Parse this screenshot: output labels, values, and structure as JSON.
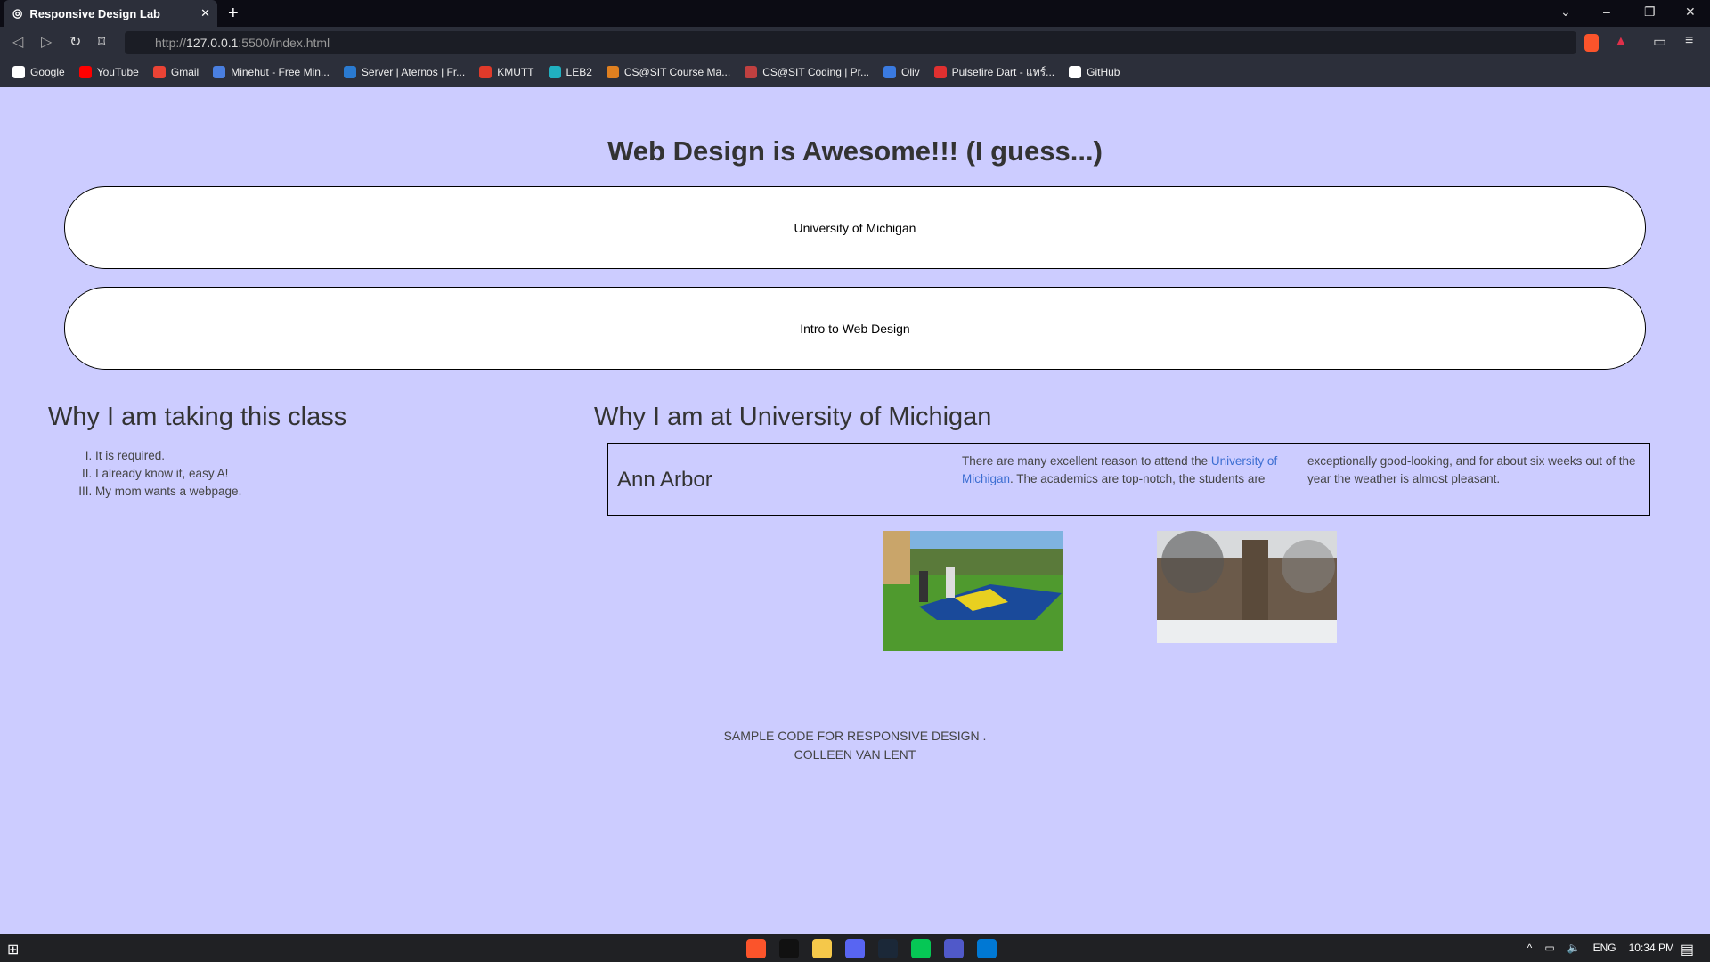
{
  "browser": {
    "tab_title": "Responsive Design Lab",
    "url_prefix": "http://",
    "url_host": "127.0.0.1",
    "url_rest": ":5500/index.html",
    "bookmarks": [
      {
        "label": "Google",
        "color": "#ffffff"
      },
      {
        "label": "YouTube",
        "color": "#ff0000"
      },
      {
        "label": "Gmail",
        "color": "#ea4335"
      },
      {
        "label": "Minehut - Free Min...",
        "color": "#4a7fe0"
      },
      {
        "label": "Server | Aternos | Fr...",
        "color": "#2a7ad0"
      },
      {
        "label": "KMUTT",
        "color": "#e03a2a"
      },
      {
        "label": "LEB2",
        "color": "#20b0c0"
      },
      {
        "label": "CS@SIT Course Ma...",
        "color": "#e08020"
      },
      {
        "label": "CS@SIT Coding | Pr...",
        "color": "#c04040"
      },
      {
        "label": "Oliv",
        "color": "#3a7ae0"
      },
      {
        "label": "Pulsefire Dart - แทร์...",
        "color": "#e03030"
      },
      {
        "label": "GitHub",
        "color": "#ffffff"
      }
    ]
  },
  "page": {
    "title": "Web Design is Awesome!!! (I guess...)",
    "box1": "University of Michigan",
    "box2": "Intro to Web Design",
    "left_heading": "Why I am taking this class",
    "reasons": [
      "It is required.",
      "I already know it, easy A!",
      "My mom wants a webpage."
    ],
    "right_heading": "Why I am at University of Michigan",
    "card_title": "Ann Arbor",
    "col1_before": "There are many excellent reason to attend the ",
    "col1_link": "University of Michigan",
    "col1_after": ". The academics are top-notch, the students are",
    "col2": "exceptionally good-looking, and for about six weeks out of the year the weather is almost pleasant.",
    "footer_line1": "SAMPLE CODE FOR RESPONSIVE DESIGN .",
    "footer_line2": "COLLEEN VAN LENT"
  },
  "taskbar": {
    "apps": [
      {
        "name": "brave",
        "color": "#fb542b"
      },
      {
        "name": "app-red",
        "color": "#111"
      },
      {
        "name": "file-explorer",
        "color": "#f5c84a"
      },
      {
        "name": "discord",
        "color": "#5865f2"
      },
      {
        "name": "steam",
        "color": "#1b2838"
      },
      {
        "name": "line",
        "color": "#06c755"
      },
      {
        "name": "teams",
        "color": "#5059c9"
      },
      {
        "name": "vscode",
        "color": "#0078d4"
      }
    ],
    "lang": "ENG",
    "time": "10:34 PM"
  }
}
